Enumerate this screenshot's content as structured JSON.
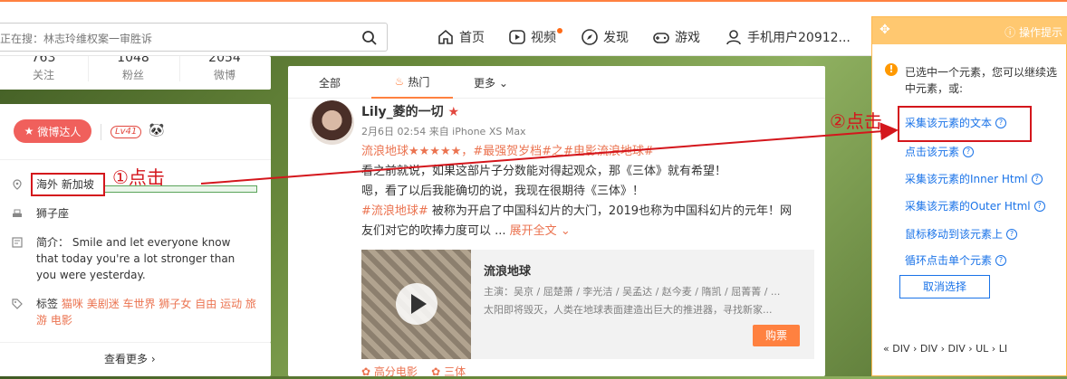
{
  "top": {
    "search_placeholder": "正在搜：林志玲维权案一审胜诉",
    "nav": [
      "首页",
      "视频",
      "发现",
      "游戏",
      "手机用户20912..."
    ]
  },
  "profile": {
    "stats": [
      {
        "num": "763",
        "label": "关注"
      },
      {
        "num": "1048",
        "label": "粉丝"
      },
      {
        "num": "2054",
        "label": "微博"
      }
    ],
    "expert_label": "微博达人",
    "level": "Lv41",
    "location": "海外 新加坡",
    "zodiac": "狮子座",
    "bio_label": "简介：",
    "bio": "Smile and let everyone know that today you're a lot stronger than you were yesterday.",
    "tags_label": "标签",
    "tags": [
      "猫咪",
      "美剧迷",
      "车世界",
      "狮子女",
      "自由",
      "运动",
      "旅游",
      "电影"
    ],
    "see_more": "查看更多"
  },
  "annotations": {
    "step1": "①点击",
    "step2": "②点击"
  },
  "feed": {
    "tabs": [
      "全部",
      "热门",
      "更多"
    ],
    "post": {
      "user": "Lily_菱的一切",
      "meta": "2月6日 02:54 来自 iPhone XS Max",
      "line1_topic": "流浪地球★★★★★，#最强贺岁档#之#电影流浪地球#",
      "line2": "看之前就说，如果这部片子分数能对得起观众，那《三体》就有希望！",
      "line3": "嗯，看了以后我能确切的说，我现在很期待《三体》！",
      "line4_tag": "#流浪地球#",
      "line4": " 被称为开启了中国科幻片的大门，2019也称为中国科幻片的元年！网",
      "line5": "友们对它的吹捧力度可以 ...",
      "expand": "展开全文",
      "movie_title": "流浪地球",
      "movie_cast": "主演：吴京 / 屈楚萧 / 李光洁 / 吴孟达 / 赵今麦 / 隋凯 / 屈菁菁 / ...",
      "movie_desc": "太阳即将毁灭，人类在地球表面建造出巨大的推进器，寻找新家...",
      "buy": "购票",
      "footer_tags": [
        "高分电影",
        "三体"
      ]
    }
  },
  "panel": {
    "title": "操作提示",
    "message": "已选中一个元素，您可以继续选中元素，或:",
    "actions": [
      "采集该元素的文本",
      "点击该元素",
      "采集该元素的Inner Html",
      "采集该元素的Outer Html",
      "鼠标移动到该元素上",
      "循环点击单个元素"
    ],
    "cancel": "取消选择",
    "breadcrumb": "« DIV › DIV › DIV › UL › LI"
  },
  "colors": {
    "accent_orange": "#ff8140",
    "highlight_red": "#d4161c",
    "link_blue": "#1a73e8",
    "expert_red": "#f0605c"
  }
}
